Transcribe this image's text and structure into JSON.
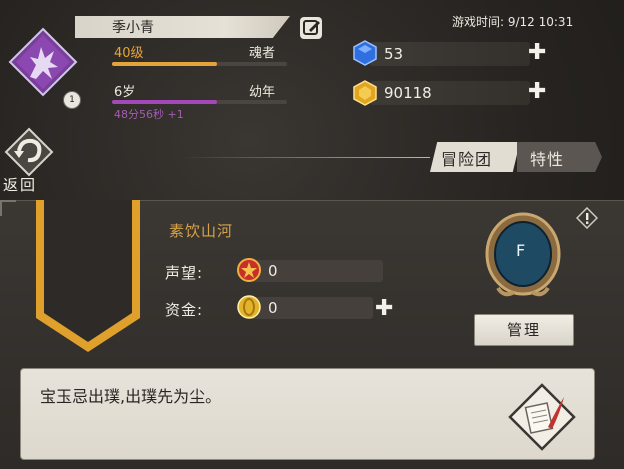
{
  "player": {
    "name": "季小青",
    "level_text": "40级",
    "rank": "魂者",
    "level_progress": 0.6,
    "age_text": "6岁",
    "age_stage": "幼年",
    "age_progress": 0.6,
    "timer": "48分56秒 +1",
    "badge": "1"
  },
  "header": {
    "game_time": "游戏时间: 9/12 10:31"
  },
  "resources": {
    "gems": "53",
    "gold": "90118"
  },
  "nav": {
    "back_label": "返回",
    "tabs": [
      "冒险团",
      "特性"
    ],
    "active_tab": "冒险团"
  },
  "guild": {
    "name": "素饮山河",
    "reputation_label": "声望:",
    "reputation_value": "0",
    "funds_label": "资金:",
    "funds_value": "0",
    "grade": "F",
    "manage_label": "管理",
    "motto": "宝玉忌出璞,出璞先为尘。"
  },
  "colors": {
    "level_bar": "#e5a43a",
    "age_bar": "#a447b8",
    "guild_name": "#d9a34a",
    "banner_gold": "#e0a02c"
  }
}
